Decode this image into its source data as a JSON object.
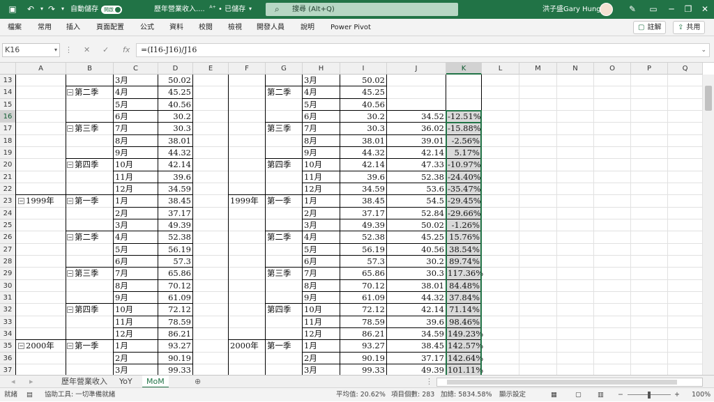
{
  "titlebar": {
    "autosave_label": "自動儲存",
    "toggle_label": "開啟",
    "doc_title": "歷年營業收入....",
    "save_state": "• 已儲存",
    "search_placeholder": "搜尋 (Alt+Q)",
    "user_name": "洪子盛Gary Hung",
    "brand_color": "#217346"
  },
  "ribbon": {
    "tabs": [
      "檔案",
      "常用",
      "插入",
      "頁面配置",
      "公式",
      "資料",
      "校閱",
      "檢視",
      "開發人員",
      "說明",
      "Power Pivot"
    ],
    "comment_button": "註解",
    "share_button": "共用"
  },
  "formula_bar": {
    "name_box": "K16",
    "formula": "=(I16-J16)/J16"
  },
  "columns": [
    "A",
    "B",
    "C",
    "D",
    "E",
    "F",
    "G",
    "H",
    "I",
    "J",
    "K",
    "L",
    "M",
    "N",
    "O",
    "P",
    "Q"
  ],
  "selected_column": "K",
  "row_numbers": [
    "13",
    "14",
    "15",
    "16",
    "17",
    "18",
    "19",
    "20",
    "21",
    "22",
    "23",
    "24",
    "25",
    "26",
    "27",
    "28",
    "29",
    "30",
    "31",
    "32",
    "33",
    "34",
    "35",
    "36",
    "37"
  ],
  "selected_row": "16",
  "left_table": {
    "years": [
      "1999年",
      "2000年"
    ],
    "quarters": [
      "第二季",
      "第三季",
      "第四季",
      "第一季",
      "第二季",
      "第三季",
      "第四季",
      "第一季"
    ],
    "months": [
      "3月",
      "4月",
      "5月",
      "6月",
      "7月",
      "8月",
      "9月",
      "10月",
      "11月",
      "12月",
      "1月",
      "2月",
      "3月",
      "4月",
      "5月",
      "6月",
      "7月",
      "8月",
      "9月",
      "10月",
      "11月",
      "12月",
      "1月",
      "2月",
      "3月"
    ],
    "values": [
      "50.02",
      "45.25",
      "40.56",
      "30.2",
      "30.3",
      "38.01",
      "44.32",
      "42.14",
      "39.6",
      "34.59",
      "38.45",
      "37.17",
      "49.39",
      "52.38",
      "56.19",
      "57.3",
      "65.86",
      "70.12",
      "61.09",
      "72.12",
      "78.59",
      "86.21",
      "93.27",
      "90.19",
      "99.33"
    ]
  },
  "right_table": {
    "years": [
      "1999年",
      "2000年"
    ],
    "quarters": [
      "第二季",
      "第三季",
      "第四季",
      "第一季",
      "第二季",
      "第三季",
      "第四季",
      "第一季"
    ],
    "months": [
      "3月",
      "4月",
      "5月",
      "6月",
      "7月",
      "8月",
      "9月",
      "10月",
      "11月",
      "12月",
      "1月",
      "2月",
      "3月",
      "4月",
      "5月",
      "6月",
      "7月",
      "8月",
      "9月",
      "10月",
      "11月",
      "12月",
      "1月",
      "2月",
      "3月"
    ],
    "values_i": [
      "50.02",
      "45.25",
      "40.56",
      "30.2",
      "30.3",
      "38.01",
      "44.32",
      "42.14",
      "39.6",
      "34.59",
      "38.45",
      "37.17",
      "49.39",
      "52.38",
      "56.19",
      "57.3",
      "65.86",
      "70.12",
      "61.09",
      "72.12",
      "78.59",
      "86.21",
      "93.27",
      "90.19",
      "99.33"
    ],
    "values_j": [
      "",
      "",
      "",
      "34.52",
      "36.02",
      "39.01",
      "42.14",
      "47.33",
      "52.38",
      "53.6",
      "54.5",
      "52.84",
      "50.02",
      "45.25",
      "40.56",
      "30.2",
      "30.3",
      "38.01",
      "44.32",
      "42.14",
      "39.6",
      "34.59",
      "38.45",
      "37.17",
      "49.39"
    ],
    "mom_k": [
      "",
      "",
      "",
      "-12.51%",
      "-15.88%",
      "-2.56%",
      "5.17%",
      "-10.97%",
      "-24.40%",
      "-35.47%",
      "-29.45%",
      "-29.66%",
      "-1.26%",
      "15.76%",
      "38.54%",
      "89.74%",
      "117.36%",
      "84.48%",
      "37.84%",
      "71.14%",
      "98.46%",
      "149.23%",
      "142.57%",
      "142.64%",
      "101.11%"
    ]
  },
  "sheet_tabs": [
    "歷年營業收入",
    "YoY",
    "MoM"
  ],
  "active_sheet": "MoM",
  "statusbar": {
    "ready": "就緒",
    "accessibility": "協助工具: 一切準備就緒",
    "average": "平均值: 20.62%",
    "count": "項目個數: 283",
    "sum": "加總: 5834.58%",
    "display_settings": "顯示設定",
    "zoom": "100%"
  }
}
